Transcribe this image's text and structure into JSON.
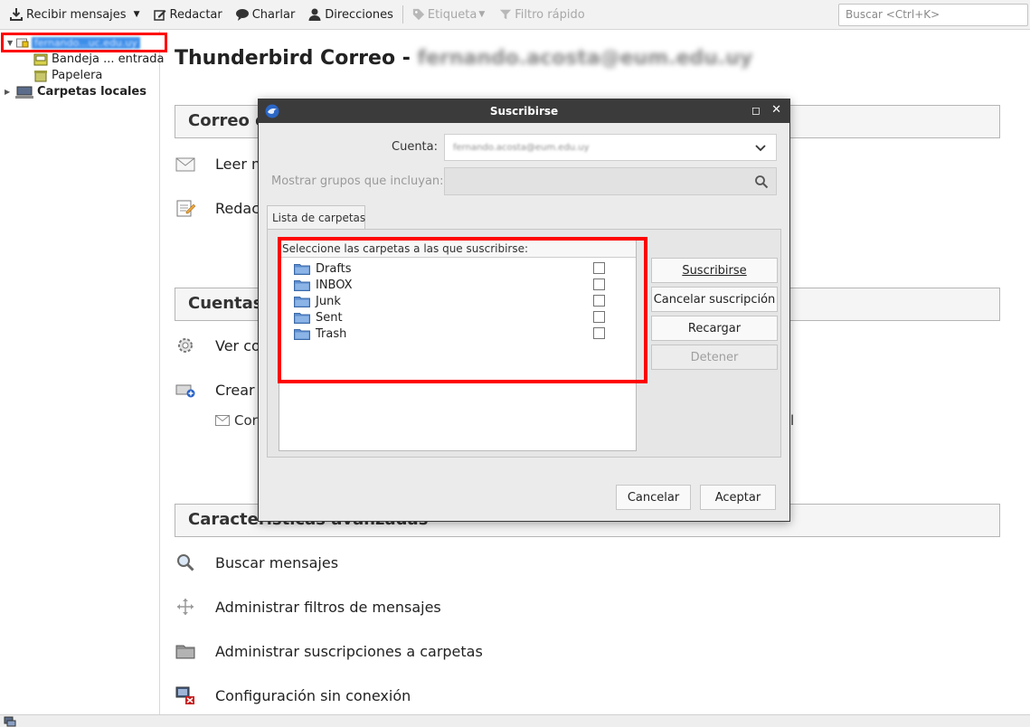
{
  "toolbar": {
    "get_mail_label": "Recibir mensajes",
    "write_label": "Redactar",
    "chat_label": "Charlar",
    "address_book_label": "Direcciones",
    "tag_label": "Etiqueta",
    "quick_filter_label": "Filtro rápido",
    "search_placeholder": "Buscar <Ctrl+K>"
  },
  "sidebar": {
    "account_name": "fernando...uc.edu.uy",
    "inbox_label": "Bandeja ... entrada",
    "trash_label": "Papelera",
    "local_folders_label": "Carpetas locales"
  },
  "main": {
    "title_prefix": "Thunderbird Correo -",
    "title_account": "fernando.acosta@eum.edu.uy",
    "sections": {
      "email": "Correo electrónico",
      "accounts": "Cuentas",
      "advanced": "Características avanzadas"
    },
    "actions": {
      "read": "Leer mensajes",
      "compose": "Redactar un nuevo mensaje",
      "view_settings": "Ver configuración de esta cuenta",
      "create": "Crear una nueva cuenta:",
      "sub_email": "Correo electrónico",
      "sub_right_tail": "l",
      "search": "Buscar mensajes",
      "filters": "Administrar filtros de mensajes",
      "subscriptions": "Administrar suscripciones a carpetas",
      "offline": "Configuración sin conexión"
    }
  },
  "dialog": {
    "title": "Suscribirse",
    "account_label": "Cuenta:",
    "account_value": "fernando.acosta@eum.edu.uy",
    "filter_label": "Mostrar grupos que incluyan:",
    "tab_label": "Lista de carpetas",
    "list_header": "Seleccione las carpetas a las que suscribirse:",
    "folders": [
      {
        "name": "Drafts",
        "subscribed": false
      },
      {
        "name": "INBOX",
        "subscribed": false
      },
      {
        "name": "Junk",
        "subscribed": false
      },
      {
        "name": "Sent",
        "subscribed": false
      },
      {
        "name": "Trash",
        "subscribed": false
      }
    ],
    "buttons": {
      "subscribe": "Suscribirse",
      "unsubscribe": "Cancelar suscripción",
      "refresh": "Recargar",
      "stop": "Detener",
      "cancel": "Cancelar",
      "ok": "Aceptar"
    }
  },
  "colors": {
    "highlight_frame": "#ff0000",
    "dialog_titlebar": "#3b3b3b",
    "selection": "#3d8ee9"
  }
}
